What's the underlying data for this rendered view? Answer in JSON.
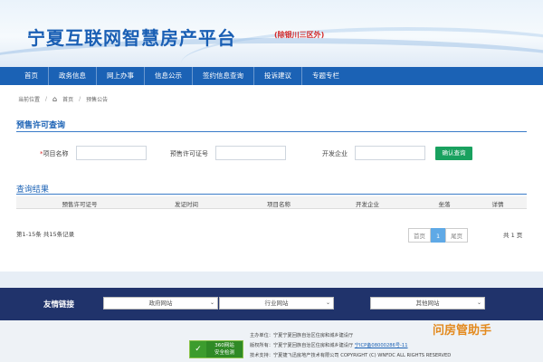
{
  "header": {
    "title": "宁夏互联网智慧房产平台",
    "subtitle": "(除银川三区外)"
  },
  "nav": {
    "items": [
      "首页",
      "政务信息",
      "网上办事",
      "信息公示",
      "签约信息查询",
      "投诉建议",
      "专题专栏"
    ]
  },
  "breadcrumb": {
    "prefix": "当前位置",
    "home": "首页",
    "current": "预售公告"
  },
  "search": {
    "section_title": "预售许可查询",
    "fields": [
      {
        "label": "项目名称",
        "required": true,
        "value": ""
      },
      {
        "label": "预售许可证号",
        "required": false,
        "value": ""
      },
      {
        "label": "开发企业",
        "required": false,
        "value": ""
      }
    ],
    "button_label": "确认查询"
  },
  "results": {
    "section_title": "查询结果",
    "columns": [
      "预售许可证号",
      "发证时间",
      "项目名称",
      "开发企业",
      "坐落",
      "详情"
    ],
    "count_text": "第1-15条  共15条记录",
    "pager": {
      "first": "首页",
      "current": "1",
      "last": "尾页"
    },
    "total_text": "共  1  页"
  },
  "footer": {
    "links_title": "友情链接",
    "selects": [
      "政府网站",
      "行业网站",
      "其他网站"
    ],
    "host": "主办单位：宁夏宁夏回族自治区住房和城乡建设厅",
    "copyright_prefix": "版权所有：宁夏宁夏回族自治区住房和城乡建设厅 ",
    "icp": "宁ICP备08000286号-11",
    "support": "技术支持：宁夏捷飞迅房地产技术有限公司 COPYRIGHT (C) WNFDC ALL RIGHTS RESERVED",
    "badge_line1": "360网站",
    "badge_line2": "安全检测",
    "helper": "问房管助手"
  },
  "colors": {
    "nav": "#1b62b5",
    "accent_red": "#d42b2b",
    "query_button": "#19a15f",
    "footer_bar": "#20336b"
  }
}
